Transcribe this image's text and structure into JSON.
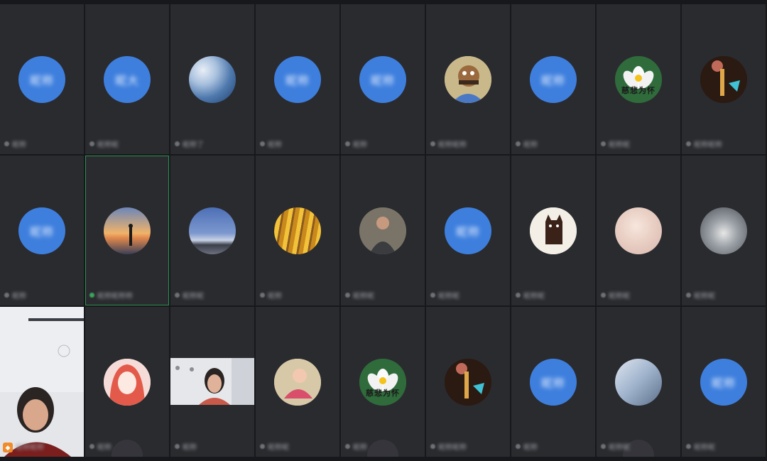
{
  "tiles": [
    {
      "avatar": "blue",
      "avatar_text": "昵称",
      "name": "昵称"
    },
    {
      "avatar": "blue",
      "avatar_text": "昵大",
      "name": "昵称昵"
    },
    {
      "avatar": "img-wave",
      "name": "昵称了"
    },
    {
      "avatar": "blue",
      "avatar_text": "昵称",
      "name": "昵称"
    },
    {
      "avatar": "blue",
      "avatar_text": "昵称",
      "name": "昵称"
    },
    {
      "avatar": "img-cartoon",
      "name": "昵称昵称"
    },
    {
      "avatar": "blue",
      "avatar_text": "昵称",
      "name": "昵称"
    },
    {
      "avatar": "img-lotus",
      "overlay_text": "慈悲为怀",
      "name": "昵称昵"
    },
    {
      "avatar": "img-toy",
      "name": "昵称昵称"
    },
    {
      "avatar": "blue",
      "avatar_text": "昵称",
      "name": "昵称"
    },
    {
      "avatar": "img-sunset",
      "name": "昵称昵称称",
      "active": true
    },
    {
      "avatar": "img-lake",
      "name": "昵称昵"
    },
    {
      "avatar": "img-forest",
      "name": "昵称"
    },
    {
      "avatar": "img-man",
      "name": "昵称昵"
    },
    {
      "avatar": "blue",
      "avatar_text": "昵称",
      "name": "昵称昵"
    },
    {
      "avatar": "img-cat",
      "name": "昵称昵"
    },
    {
      "avatar": "img-baby",
      "name": "昵称昵"
    },
    {
      "avatar": "img-wolf",
      "name": "昵称昵"
    },
    {
      "avatar": "video-woman",
      "name": "昵称昵称"
    },
    {
      "avatar": "img-anime",
      "name": "昵称"
    },
    {
      "avatar": "video-room",
      "name": "昵称"
    },
    {
      "avatar": "img-girl",
      "name": "昵称昵"
    },
    {
      "avatar": "img-lotus",
      "overlay_text": "慈悲为怀",
      "name": "昵称"
    },
    {
      "avatar": "img-toy",
      "name": "昵称昵称"
    },
    {
      "avatar": "blue",
      "avatar_text": "昵称",
      "name": "昵称"
    },
    {
      "avatar": "img-photo",
      "name": "昵称昵"
    },
    {
      "avatar": "blue",
      "avatar_text": "昵称",
      "name": "昵称昵"
    }
  ]
}
